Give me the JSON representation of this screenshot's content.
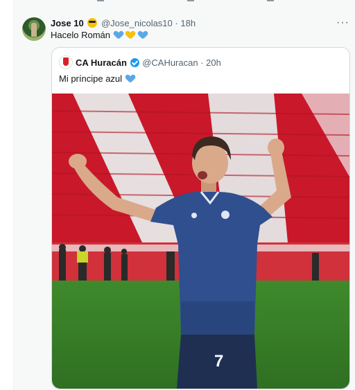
{
  "tweet": {
    "display_name": "Jose 10",
    "handle": "@Jose_nicolas10",
    "time": "18h",
    "text": "Hacelo Román",
    "more_glyph": "···",
    "avatar": "user-avatar"
  },
  "quoted": {
    "display_name": "CA Huracán",
    "handle": "@CAHuracan",
    "time": "20h",
    "text": "Mi príncipe azul",
    "verified": true,
    "avatar": "club-crest-avatar",
    "jersey_number": "7"
  },
  "colors": {
    "accent": "#1d9bf0",
    "background": "#f7f9f9",
    "jersey": "#2f4f8f",
    "stadium_red": "#c9182a"
  }
}
